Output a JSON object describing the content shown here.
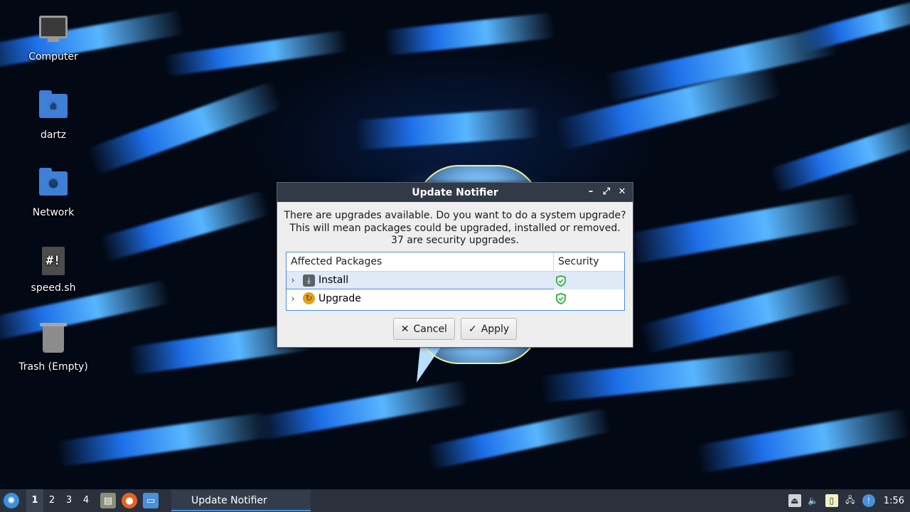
{
  "desktop": {
    "icons": [
      {
        "label": "Computer",
        "icon": "computer-icon"
      },
      {
        "label": "dartz",
        "icon": "home-folder-icon"
      },
      {
        "label": "Network",
        "icon": "network-folder-icon"
      },
      {
        "label": "speed.sh",
        "icon": "shell-script-icon",
        "glyph": "#!"
      },
      {
        "label": "Trash (Empty)",
        "icon": "trash-icon"
      }
    ]
  },
  "dialog": {
    "title": "Update Notifier",
    "message_line1": "There are upgrades available. Do you want to do a system upgrade?",
    "message_line2": "This will mean packages could be upgraded, installed or removed.",
    "message_line3": "37 are security upgrades.",
    "columns": {
      "packages": "Affected Packages",
      "security": "Security"
    },
    "rows": [
      {
        "label": "Install",
        "icon": "download-icon",
        "security": "shield-check-icon",
        "selected": true
      },
      {
        "label": "Upgrade",
        "icon": "upgrade-icon",
        "security": "shield-check-icon",
        "selected": false
      }
    ],
    "cancel_label": "Cancel",
    "apply_label": "Apply"
  },
  "taskbar": {
    "desktops": [
      "1",
      "2",
      "3",
      "4"
    ],
    "active_desktop": "1",
    "task_title": "Update Notifier",
    "clock": "1:56"
  },
  "colors": {
    "titlebar": "#323a48",
    "taskbar": "#2a313d",
    "accent": "#4a90d9",
    "shield": "#3bb54a"
  }
}
